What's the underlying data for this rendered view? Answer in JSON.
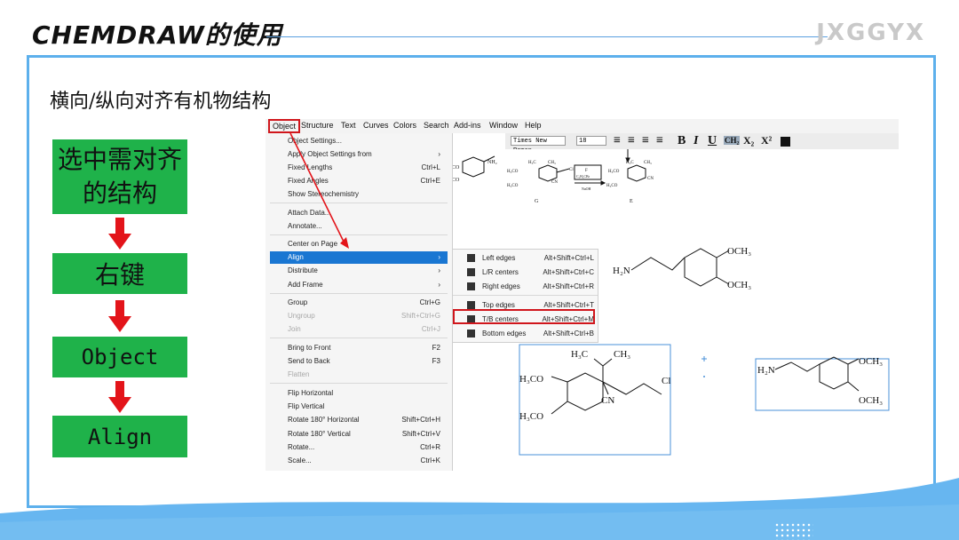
{
  "slide": {
    "title": "CHEMDRAW的使用",
    "brand": "JXGGYX",
    "subtitle": "横向/纵向对齐有机物结构"
  },
  "flow": {
    "step1": "选中需对齐的结构",
    "step2": "右键",
    "step3": "Object",
    "step4": "Align"
  },
  "app": {
    "menubar": [
      "Object",
      "Structure",
      "Text",
      "Curves",
      "Colors",
      "Search",
      "Add-ins",
      "Window",
      "Help"
    ],
    "font_select": "Times New Roman",
    "size_select": "18",
    "object_menu": [
      {
        "label": "Object Settings...",
        "shortcut": ""
      },
      {
        "label": "Apply Object Settings from",
        "shortcut": "›"
      },
      {
        "label": "Fixed Lengths",
        "shortcut": "Ctrl+L"
      },
      {
        "label": "Fixed Angles",
        "shortcut": "Ctrl+E"
      },
      {
        "label": "Show Stereochemistry",
        "shortcut": ""
      },
      {
        "label": "Attach Data...",
        "shortcut": ""
      },
      {
        "label": "Annotate...",
        "shortcut": ""
      },
      {
        "label": "Center on Page",
        "shortcut": ""
      },
      {
        "label": "Align",
        "shortcut": "›"
      },
      {
        "label": "Distribute",
        "shortcut": "›"
      },
      {
        "label": "Add Frame",
        "shortcut": "›"
      },
      {
        "label": "Group",
        "shortcut": "Ctrl+G"
      },
      {
        "label": "Ungroup",
        "shortcut": "Shift+Ctrl+G"
      },
      {
        "label": "Join",
        "shortcut": "Ctrl+J"
      },
      {
        "label": "Bring to Front",
        "shortcut": "F2"
      },
      {
        "label": "Send to Back",
        "shortcut": "F3"
      },
      {
        "label": "Flatten",
        "shortcut": ""
      },
      {
        "label": "Flip Horizontal",
        "shortcut": ""
      },
      {
        "label": "Flip Vertical",
        "shortcut": ""
      },
      {
        "label": "Rotate 180° Horizontal",
        "shortcut": "Shift+Ctrl+H"
      },
      {
        "label": "Rotate 180° Vertical",
        "shortcut": "Shift+Ctrl+V"
      },
      {
        "label": "Rotate...",
        "shortcut": "Ctrl+R"
      },
      {
        "label": "Scale...",
        "shortcut": "Ctrl+K"
      }
    ],
    "align_submenu": [
      {
        "label": "Left edges",
        "shortcut": "Alt+Shift+Ctrl+L"
      },
      {
        "label": "L/R centers",
        "shortcut": "Alt+Shift+Ctrl+C"
      },
      {
        "label": "Right edges",
        "shortcut": "Alt+Shift+Ctrl+R"
      },
      {
        "label": "Top edges",
        "shortcut": "Alt+Shift+Ctrl+T"
      },
      {
        "label": "T/B centers",
        "shortcut": "Alt+Shift+Ctrl+M"
      },
      {
        "label": "Bottom edges",
        "shortcut": "Alt+Shift+Ctrl+B"
      }
    ],
    "molecules": {
      "amine_label": "H₂N",
      "och3": "OCH₃",
      "h3co": "H₃CO",
      "h3c": "H₃C",
      "ch3": "CH₃",
      "cl": "Cl",
      "cn": "CN",
      "scheme_labels": [
        "G",
        "E"
      ],
      "reagent_top": "F",
      "reagent_mid": "C₂H₅CBr",
      "reagent_bottom": "NaOH"
    }
  }
}
